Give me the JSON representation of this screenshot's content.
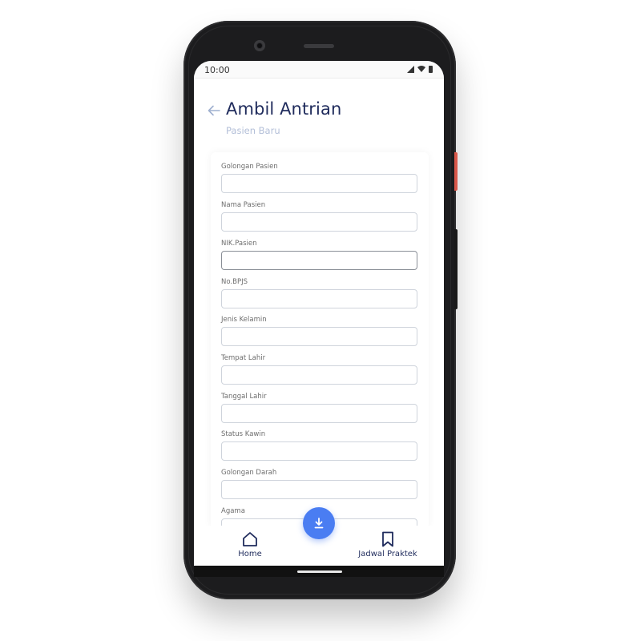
{
  "status_bar": {
    "time": "10:00"
  },
  "header": {
    "title": "Ambil Antrian",
    "subtitle": "Pasien Baru"
  },
  "form": {
    "fields": [
      {
        "label": "Golongan Pasien",
        "value": ""
      },
      {
        "label": "Nama Pasien",
        "value": ""
      },
      {
        "label": "NIK.Pasien",
        "value": ""
      },
      {
        "label": "No.BPJS",
        "value": ""
      },
      {
        "label": "Jenis Kelamin",
        "value": ""
      },
      {
        "label": "Tempat Lahir",
        "value": ""
      },
      {
        "label": "Tanggal Lahir",
        "value": ""
      },
      {
        "label": "Status Kawin",
        "value": ""
      },
      {
        "label": "Golongan Darah",
        "value": ""
      },
      {
        "label": "Agama",
        "value": ""
      }
    ]
  },
  "bottom_nav": {
    "items": [
      {
        "label": "Home",
        "icon": "home-icon"
      },
      {
        "label": "Jadwal Praktek",
        "icon": "bookmark-icon"
      }
    ]
  },
  "fab": {
    "icon": "download-icon"
  },
  "colors": {
    "accent": "#4a7df2",
    "title": "#1f2b5c",
    "subtitle": "#b3bfd8"
  }
}
